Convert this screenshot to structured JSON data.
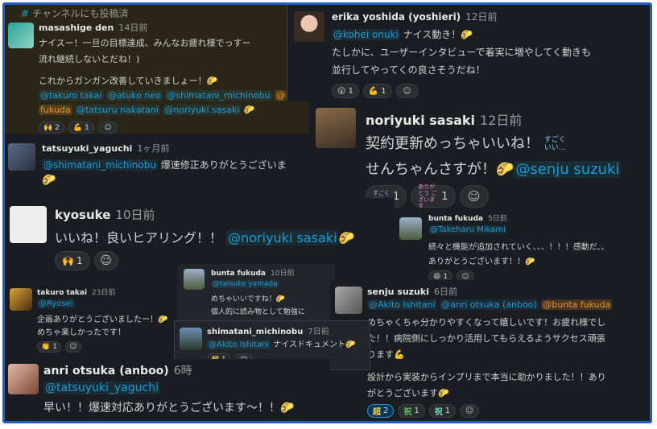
{
  "channel_note": "チャンネルにも投稿済",
  "messages": {
    "masashige": {
      "name": "masashige den",
      "time": "14日前",
      "line1": "ナイスー！一旦の目標達成、みんなお疲れ様でっすー",
      "line2": "流れ継続しないとだね！)",
      "line3": "これからガンガン改善していきましょー！",
      "mentions": [
        "@takuro takai",
        "@atuko neo",
        "@shimatani_michinobu",
        "@",
        "fukuda",
        "@tatsuru nakatani",
        "@noriyuki sasaki"
      ],
      "reactions": [
        {
          "emoji": "🙌",
          "count": "2"
        },
        {
          "emoji": "💪",
          "count": "1"
        }
      ]
    },
    "erika": {
      "name": "erika yoshida (yoshieri)",
      "time": "12日前",
      "mention": "@kohei onuki",
      "line1": "ナイス動き！",
      "line2": "たしかに、ユーザーインタビューで着実に増やしてく動きも",
      "line3": "並行してやってくの良さそうだね！",
      "reactions": [
        {
          "emoji": "😮",
          "count": "1"
        },
        {
          "emoji": "💪",
          "count": "1"
        }
      ]
    },
    "noriyuki": {
      "name": "noriyuki sasaki",
      "time": "12日前",
      "line1": "契約更新めっちゃいいね！",
      "line2": "せんちゃんさすが！",
      "mention": "@senju suzuki",
      "sticker": "すごく いい…",
      "reactions": [
        {
          "emoji": "すごく いい…",
          "count": "1"
        },
        {
          "emoji": "ありがとう ございます",
          "count": "1"
        }
      ]
    },
    "tatsuyuki": {
      "name": "tatsuyuki_yaguchi",
      "time": "1ヶ月前",
      "mention": "@shimatani_michinobu",
      "line1": "爆速修正ありがとうございま"
    },
    "kyosuke": {
      "name": "kyosuke",
      "time": "10日前",
      "line1": "いいね！良いヒアリング！！",
      "mention": "@noriyuki sasaki",
      "reactions": [
        {
          "emoji": "🙌",
          "count": "1"
        }
      ]
    },
    "bunta1": {
      "name": "bunta fukuda",
      "time": "5日前",
      "mention": "@Takeharu Mikami",
      "line1": "続々と機能が追加されていく、、、！！！感動だ、、",
      "line2": "ありがとうございます！！",
      "reactions": [
        {
          "emoji": "😄",
          "count": "1"
        }
      ]
    },
    "bunta2": {
      "name": "bunta fukuda",
      "time": "10日前",
      "mention": "@taisuke yamada",
      "line1": "めちゃいいですね！",
      "line2": "個人的に読み物として勉強に"
    },
    "takuro": {
      "name": "takuro takai",
      "time": "23日前",
      "mention": "@Ryosei",
      "line1": "企画ありがとうございましたー！",
      "line2": "めちゃ楽しかったです！",
      "reactions": [
        {
          "emoji": "👏",
          "count": "1"
        }
      ]
    },
    "senju": {
      "name": "senju suzuki",
      "time": "6日前",
      "mentions": [
        "@Akito Ishitani",
        "@anri otsuka (anboo)",
        "@bunta fukuda"
      ],
      "line1": "めちゃくちゃ分かりやすくなって嬉しいです！お疲れ様でし",
      "line2": "た！！病院側にしっかり活用してもらえるようサクセス頑張",
      "line3": "ります",
      "line4": "設計から実装からインプリまで本当に助かりました！！あり",
      "line5": "がとうございます",
      "reactions": [
        {
          "emoji": "超",
          "count": "2"
        },
        {
          "emoji": "祝",
          "count": "1"
        },
        {
          "emoji": "祝",
          "count": "1"
        }
      ]
    },
    "shimatani": {
      "name": "shimatani_michinobu",
      "time": "7日前",
      "mention": "@Akito Ishitani",
      "line1": "ナイスドキュメント",
      "reactions": [
        {
          "emoji": "超",
          "count": "1"
        }
      ]
    },
    "anri": {
      "name": "anri otsuka (anboo)",
      "time": "6時",
      "mention": "@tatsuyuki_yaguchi",
      "line1": "早い！！爆速対応ありがとうございます〜！！"
    }
  },
  "colors": {
    "background": "#1a1d21",
    "mention": "#1d9bd1",
    "highlight": "#e8912d",
    "frame": "#1f5fc4"
  }
}
